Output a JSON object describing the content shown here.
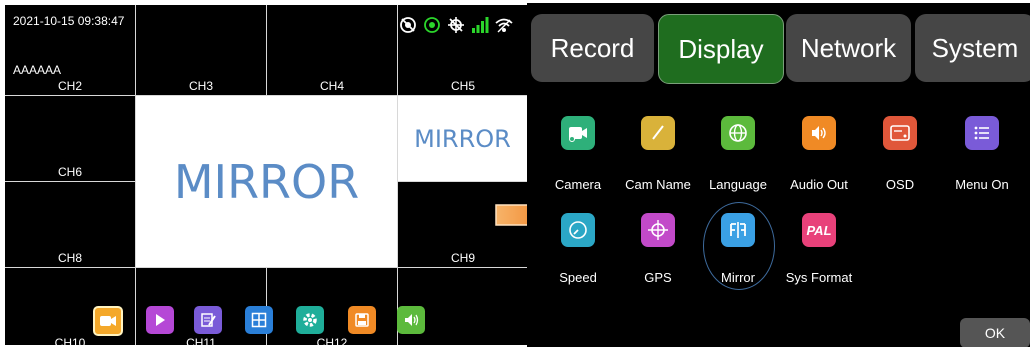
{
  "dvr": {
    "timestamp": "2021-10-15 09:38:47",
    "overlay_text": "AAAAAA",
    "mirror_large": "MIRROR",
    "mirror_small": "MIRROR",
    "channels": [
      "CH2",
      "CH3",
      "CH4",
      "CH5",
      "CH6",
      "CH8",
      "CH9",
      "CH10",
      "CH11",
      "CH12"
    ],
    "status_icons": [
      "no-record-icon",
      "record-icon",
      "gps-off-icon",
      "signal-icon",
      "wifi-icon"
    ],
    "toolbar_icons": [
      "camera-icon",
      "play-icon",
      "edit-icon",
      "layout-icon",
      "settings-icon",
      "save-icon",
      "volume-icon"
    ],
    "colors": {
      "signal": "#2bd62b",
      "mirror_text": "#5b8cc6"
    }
  },
  "settings": {
    "tabs": [
      {
        "label": "Record",
        "active": false
      },
      {
        "label": "Display",
        "active": true
      },
      {
        "label": "Network",
        "active": false
      },
      {
        "label": "System",
        "active": false
      }
    ],
    "items": [
      {
        "label": "Camera",
        "icon": "camera-icon",
        "color": "#2eb07a"
      },
      {
        "label": "Cam Name",
        "icon": "pencil-icon",
        "color": "#d9b23a"
      },
      {
        "label": "Language",
        "icon": "globe-icon",
        "color": "#5cba3c"
      },
      {
        "label": "Audio Out",
        "icon": "speaker-icon",
        "color": "#f08a25"
      },
      {
        "label": "OSD",
        "icon": "osd-icon",
        "color": "#e0573a"
      },
      {
        "label": "Menu On",
        "icon": "menu-icon",
        "color": "#7a5bd8"
      },
      {
        "label": "Speed",
        "icon": "speedometer-icon",
        "color": "#2ba7c6"
      },
      {
        "label": "GPS",
        "icon": "crosshair-icon",
        "color": "#c24ac9"
      },
      {
        "label": "Mirror",
        "icon": "mirror-icon",
        "color": "#3aa0e4",
        "selected": true
      },
      {
        "label": "Sys Format",
        "icon": "pal-icon",
        "color": "#e8417a",
        "icon_text": "PAL"
      }
    ],
    "ok_label": "OK"
  }
}
